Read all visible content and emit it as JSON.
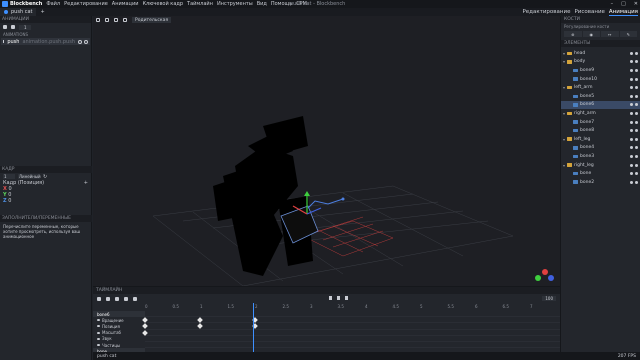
{
  "titlebar": {
    "app": "Blockbench",
    "menus": [
      "Файл",
      "Редактирование",
      "Анимации",
      "Ключевой кадр",
      "Таймлайн",
      "Инструменты",
      "Вид",
      "Помощь",
      "CPM"
    ],
    "window_title": "push cat - Blockbench",
    "controls": [
      "–",
      "□",
      "✕"
    ]
  },
  "tabs": {
    "active": "push cat",
    "add": "+"
  },
  "modes": [
    "Редактирование",
    "Рисование",
    "Анимация"
  ],
  "left": {
    "anim_header": "АНИМАЦИИ",
    "anim_field": "1",
    "sublabel": "ANIMATIONS",
    "anim_name": "push",
    "anim_sub": "animation.push.push",
    "kadr_header": "КАДР",
    "kadr_value": "1",
    "kadr_interp": "Линейный",
    "kadr_label": "Кадр (Позиция)",
    "xyz": [
      "X",
      "Y",
      "Z"
    ],
    "xyz_vals": [
      "0",
      "0",
      "0"
    ],
    "var_header": "ЗАПОЛНИТЕЛИ/ПЕРЕМЕННЫЕ",
    "var_text": "Перечислите переменные, которые хотите просмотреть, используя ваш анимационное"
  },
  "viewport": {
    "mode_select": "Родительская"
  },
  "right": {
    "header": "КОСТИ",
    "sublabel": "Регулирование кости",
    "buttons": [
      "⊕",
      "◉",
      "↔",
      "✎"
    ],
    "outliner_header": "ЭЛЕМЕНТЫ",
    "items": [
      {
        "label": "head",
        "depth": 0,
        "folder": true
      },
      {
        "label": "body",
        "depth": 0,
        "folder": true
      },
      {
        "label": "bone9",
        "depth": 1,
        "folder": false
      },
      {
        "label": "bone10",
        "depth": 1,
        "folder": false
      },
      {
        "label": "left_arm",
        "depth": 0,
        "folder": true
      },
      {
        "label": "bone5",
        "depth": 1,
        "folder": false
      },
      {
        "label": "bone6",
        "depth": 1,
        "folder": false
      },
      {
        "label": "right_arm",
        "depth": 0,
        "folder": true
      },
      {
        "label": "bone7",
        "depth": 1,
        "folder": false
      },
      {
        "label": "bone8",
        "depth": 1,
        "folder": false
      },
      {
        "label": "left_leg",
        "depth": 0,
        "folder": true
      },
      {
        "label": "bone4",
        "depth": 1,
        "folder": false
      },
      {
        "label": "bone3",
        "depth": 1,
        "folder": false
      },
      {
        "label": "right_leg",
        "depth": 0,
        "folder": true
      },
      {
        "label": "bone",
        "depth": 1,
        "folder": false
      },
      {
        "label": "bone2",
        "depth": 1,
        "folder": false
      }
    ],
    "selected_index": 6
  },
  "timeline": {
    "header": "ТАЙМЛАЙН",
    "fps": "100",
    "ruler": [
      "0",
      "0.5",
      "1",
      "1.5",
      "2",
      "2.5",
      "3",
      "3.5",
      "4",
      "4.5",
      "5",
      "5.5",
      "6",
      "6.5",
      "7"
    ],
    "channels": [
      {
        "label": "bone6",
        "bone": true
      },
      {
        "label": "Вращение",
        "bone": false
      },
      {
        "label": "Позиция",
        "bone": false
      },
      {
        "label": "Масштаб",
        "bone": false
      },
      {
        "label": "Звук",
        "bone": false
      },
      {
        "label": "Частицы",
        "bone": false
      },
      {
        "label": "bone",
        "bone": true
      }
    ],
    "keyframes_sec": [
      {
        "lane": 1,
        "t": [
          0,
          1,
          2
        ]
      },
      {
        "lane": 2,
        "t": [
          0,
          1,
          2
        ]
      },
      {
        "lane": 3,
        "t": [
          0
        ]
      }
    ],
    "playhead_sec": 2
  },
  "statusbar": {
    "file": "push cat",
    "fps_readout": "207 FPS"
  }
}
